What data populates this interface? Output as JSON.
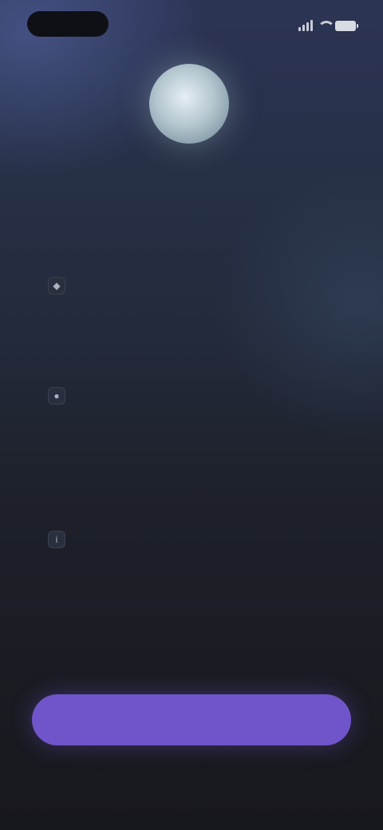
{
  "status_bar": {
    "time": "",
    "icons": [
      "signal-icon",
      "wifi-icon",
      "battery-icon"
    ]
  },
  "hero": {
    "icon": "orb-icon"
  },
  "page_title": "",
  "sections": [
    {
      "icon": "shield-icon",
      "glyph": "◆",
      "title": "",
      "body": ""
    },
    {
      "icon": "lock-icon",
      "glyph": "●",
      "title": "",
      "body": ""
    },
    {
      "icon": "info-icon",
      "glyph": "i",
      "title": "",
      "body": ""
    }
  ],
  "footer": {
    "text": "",
    "link_text": ""
  },
  "primary_button": {
    "label": ""
  },
  "secondary_link": {
    "label": ""
  },
  "colors": {
    "background_top": "#2c3454",
    "background_bottom": "#17181d",
    "accent": "#6f55c9",
    "link": "#3f7d9a"
  }
}
